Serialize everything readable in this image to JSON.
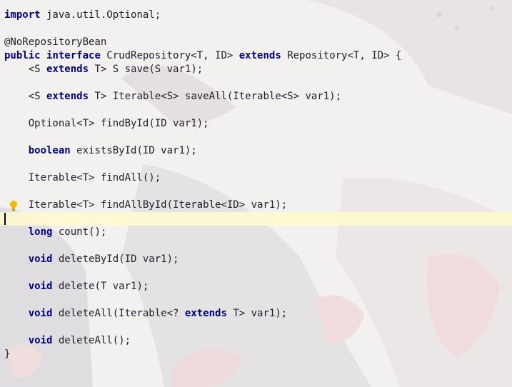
{
  "editor": {
    "lines": [
      {
        "text": "import java.util.Optional;",
        "kw": [
          "import"
        ]
      },
      {
        "text": "",
        "kw": []
      },
      {
        "text": "@NoRepositoryBean",
        "kw": []
      },
      {
        "text": "public interface CrudRepository<T, ID> extends Repository<T, ID> {",
        "kw": [
          "public",
          "interface",
          "extends"
        ]
      },
      {
        "text": "    <S extends T> S save(S var1);",
        "kw": [
          "extends"
        ]
      },
      {
        "text": "",
        "kw": []
      },
      {
        "text": "    <S extends T> Iterable<S> saveAll(Iterable<S> var1);",
        "kw": [
          "extends"
        ]
      },
      {
        "text": "",
        "kw": []
      },
      {
        "text": "    Optional<T> findById(ID var1);",
        "kw": []
      },
      {
        "text": "",
        "kw": []
      },
      {
        "text": "    boolean existsById(ID var1);",
        "kw": [
          "boolean"
        ]
      },
      {
        "text": "",
        "kw": []
      },
      {
        "text": "    Iterable<T> findAll();",
        "kw": []
      },
      {
        "text": "",
        "kw": []
      },
      {
        "text": "    Iterable<T> findAllById(Iterable<ID> var1);",
        "kw": []
      },
      {
        "text": "",
        "kw": [],
        "current": true
      },
      {
        "text": "    long count();",
        "kw": [
          "long"
        ]
      },
      {
        "text": "",
        "kw": []
      },
      {
        "text": "    void deleteById(ID var1);",
        "kw": [
          "void"
        ]
      },
      {
        "text": "",
        "kw": []
      },
      {
        "text": "    void delete(T var1);",
        "kw": [
          "void"
        ]
      },
      {
        "text": "",
        "kw": []
      },
      {
        "text": "    void deleteAll(Iterable<? extends T> var1);",
        "kw": [
          "void",
          "extends"
        ]
      },
      {
        "text": "",
        "kw": []
      },
      {
        "text": "    void deleteAll();",
        "kw": [
          "void"
        ]
      },
      {
        "text": "}",
        "kw": []
      }
    ],
    "intention_bulb_line": 14,
    "colors": {
      "keyword": "#000080",
      "current_line": "#fffacd",
      "bulb": "#f5b800"
    }
  }
}
